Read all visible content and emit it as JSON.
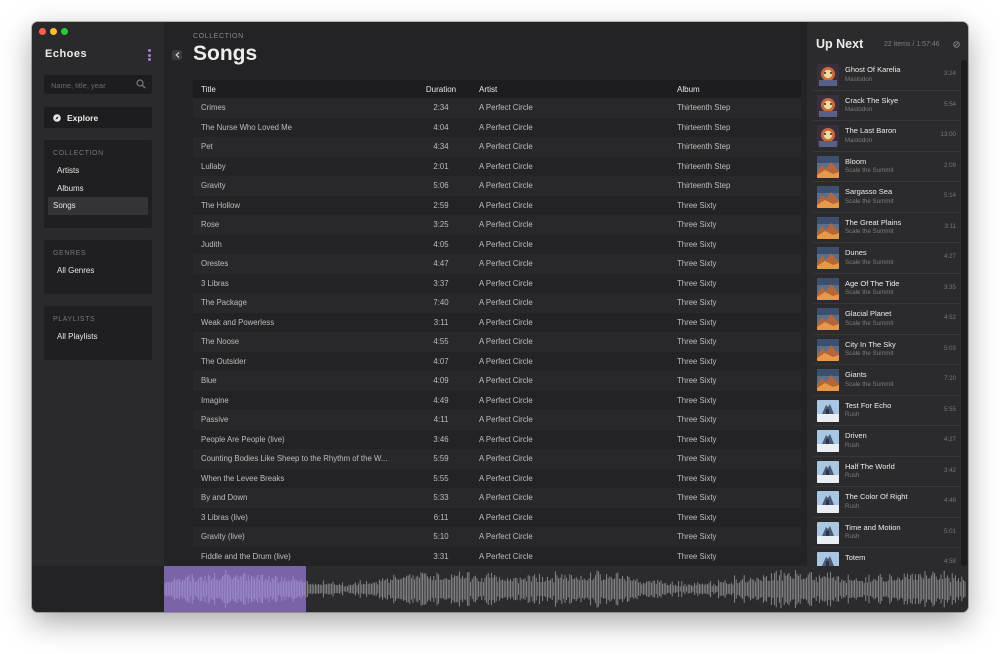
{
  "window": {
    "traffic_lights": {
      "close": "#ff5f57",
      "minimize": "#febc2e",
      "zoom": "#28c840"
    }
  },
  "sidebar": {
    "app_title": "Echoes",
    "search": {
      "placeholder": "Name, title, year",
      "value": ""
    },
    "explore_label": "Explore",
    "collection": {
      "header": "COLLECTION",
      "items": [
        "Artists",
        "Albums",
        "Songs"
      ],
      "active": "Songs"
    },
    "genres": {
      "header": "GENRES",
      "items": [
        "All Genres"
      ]
    },
    "playlists": {
      "header": "PLAYLISTS",
      "items": [
        "All Playlists"
      ]
    }
  },
  "main": {
    "eyebrow": "COLLECTION",
    "title": "Songs",
    "columns": {
      "title": "Title",
      "duration": "Duration",
      "artist": "Artist",
      "album": "Album"
    },
    "rows": [
      [
        "Crimes",
        "2:34",
        "A Perfect Circle",
        "Thirteenth Step"
      ],
      [
        "The Nurse Who Loved Me",
        "4:04",
        "A Perfect Circle",
        "Thirteenth Step"
      ],
      [
        "Pet",
        "4:34",
        "A Perfect Circle",
        "Thirteenth Step"
      ],
      [
        "Lullaby",
        "2:01",
        "A Perfect Circle",
        "Thirteenth Step"
      ],
      [
        "Gravity",
        "5:06",
        "A Perfect Circle",
        "Thirteenth Step"
      ],
      [
        "The Hollow",
        "2:59",
        "A Perfect Circle",
        "Three Sixty"
      ],
      [
        "Rose",
        "3:25",
        "A Perfect Circle",
        "Three Sixty"
      ],
      [
        "Judith",
        "4:05",
        "A Perfect Circle",
        "Three Sixty"
      ],
      [
        "Orestes",
        "4:47",
        "A Perfect Circle",
        "Three Sixty"
      ],
      [
        "3 Libras",
        "3:37",
        "A Perfect Circle",
        "Three Sixty"
      ],
      [
        "The Package",
        "7:40",
        "A Perfect Circle",
        "Three Sixty"
      ],
      [
        "Weak and Powerless",
        "3:11",
        "A Perfect Circle",
        "Three Sixty"
      ],
      [
        "The Noose",
        "4:55",
        "A Perfect Circle",
        "Three Sixty"
      ],
      [
        "The Outsider",
        "4:07",
        "A Perfect Circle",
        "Three Sixty"
      ],
      [
        "Blue",
        "4:09",
        "A Perfect Circle",
        "Three Sixty"
      ],
      [
        "Imagine",
        "4:49",
        "A Perfect Circle",
        "Three Sixty"
      ],
      [
        "Passive",
        "4:11",
        "A Perfect Circle",
        "Three Sixty"
      ],
      [
        "People Are People (live)",
        "3:46",
        "A Perfect Circle",
        "Three Sixty"
      ],
      [
        "Counting Bodies Like Sheep to the Rhythm of the W...",
        "5:59",
        "A Perfect Circle",
        "Three Sixty"
      ],
      [
        "When the Levee Breaks",
        "5:55",
        "A Perfect Circle",
        "Three Sixty"
      ],
      [
        "By and Down",
        "5:33",
        "A Perfect Circle",
        "Three Sixty"
      ],
      [
        "3 Libras (live)",
        "6:11",
        "A Perfect Circle",
        "Three Sixty"
      ],
      [
        "Gravity (live)",
        "5:10",
        "A Perfect Circle",
        "Three Sixty"
      ],
      [
        "Fiddle and the Drum (live)",
        "3:31",
        "A Perfect Circle",
        "Three Sixty"
      ]
    ]
  },
  "up_next": {
    "title": "Up Next",
    "meta": "22 items / 1:57:46",
    "items": [
      {
        "title": "Ghost Of Karelia",
        "artist": "Mastodon",
        "duration": "3:24",
        "art": "mastodon"
      },
      {
        "title": "Crack The Skye",
        "artist": "Mastodon",
        "duration": "5:54",
        "art": "mastodon"
      },
      {
        "title": "The Last Baron",
        "artist": "Mastodon",
        "duration": "13:00",
        "art": "mastodon"
      },
      {
        "title": "Bloom",
        "artist": "Scale the Summit",
        "duration": "2:09",
        "art": "summit"
      },
      {
        "title": "Sargasso Sea",
        "artist": "Scale the Summit",
        "duration": "5:14",
        "art": "summit"
      },
      {
        "title": "The Great Plains",
        "artist": "Scale the Summit",
        "duration": "3:11",
        "art": "summit"
      },
      {
        "title": "Dunes",
        "artist": "Scale the Summit",
        "duration": "4:27",
        "art": "summit"
      },
      {
        "title": "Age Of The Tide",
        "artist": "Scale the Summit",
        "duration": "3:35",
        "art": "summit"
      },
      {
        "title": "Glacial Planet",
        "artist": "Scale the Summit",
        "duration": "4:52",
        "art": "summit"
      },
      {
        "title": "City In The Sky",
        "artist": "Scale the Summit",
        "duration": "5:03",
        "art": "summit"
      },
      {
        "title": "Giants",
        "artist": "Scale the Summit",
        "duration": "7:20",
        "art": "summit"
      },
      {
        "title": "Test For Echo",
        "artist": "Rush",
        "duration": "5:55",
        "art": "rush"
      },
      {
        "title": "Driven",
        "artist": "Rush",
        "duration": "4:27",
        "art": "rush"
      },
      {
        "title": "Half The World",
        "artist": "Rush",
        "duration": "3:42",
        "art": "rush"
      },
      {
        "title": "The Color Of Right",
        "artist": "Rush",
        "duration": "4:48",
        "art": "rush"
      },
      {
        "title": "Time and Motion",
        "artist": "Rush",
        "duration": "5:01",
        "art": "rush"
      },
      {
        "title": "Totem",
        "artist": "",
        "duration": "4:58",
        "art": "rush"
      }
    ]
  },
  "player": {
    "progress_fraction": 0.176,
    "progress_color": "#7a64a8"
  }
}
